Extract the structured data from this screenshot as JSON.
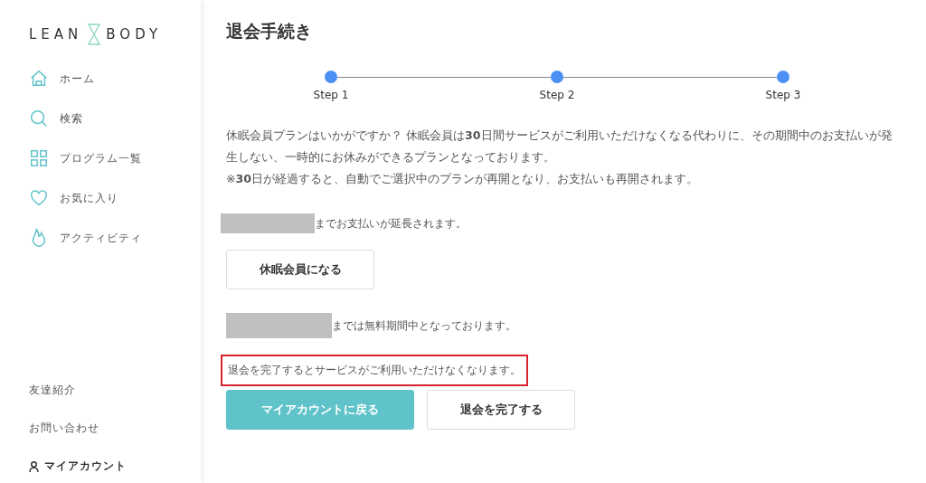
{
  "sidebar": {
    "logo": {
      "left": "LEAN",
      "right": "BODY"
    },
    "nav": [
      {
        "label": "ホーム"
      },
      {
        "label": "検索"
      },
      {
        "label": "プログラム一覧"
      },
      {
        "label": "お気に入り"
      },
      {
        "label": "アクティビティ"
      }
    ],
    "footer": [
      {
        "label": "友達紹介",
        "kind": "plain"
      },
      {
        "label": "お問い合わせ",
        "kind": "plain"
      },
      {
        "label": "マイアカウント",
        "kind": "account"
      }
    ]
  },
  "page": {
    "title": "退会手続き",
    "steps": [
      {
        "label": "Step 1",
        "done": true
      },
      {
        "label": "Step 2",
        "done": true
      },
      {
        "label": "Step 3",
        "done": true
      }
    ],
    "description": [
      "休眠会員プランはいかがですか？ 休眠会員は**30**日間サービスがご利用いただけなくなる代わりに、その期間中のお支払いが発生しない、一時的にお休みができるプランとなっております。",
      "※**30**日が経過すると、自動でご選択中のプランが再開となり、お支払いも再開されます。"
    ],
    "pause_notice": {
      "redacted": true,
      "text": "までお支払いが延長されます。"
    },
    "pause_button": "休眠会員になる",
    "trial_notice": {
      "redacted": true,
      "text": "までは無料期間中となっております。"
    },
    "warning": {
      "text": "退会を完了するとサービスがご利用いただけなくなります。",
      "highlighted": true
    },
    "buttons": [
      {
        "label": "マイアカウントに戻る",
        "kind": "primary"
      },
      {
        "label": "退会を完了する",
        "kind": "secondary"
      }
    ]
  }
}
